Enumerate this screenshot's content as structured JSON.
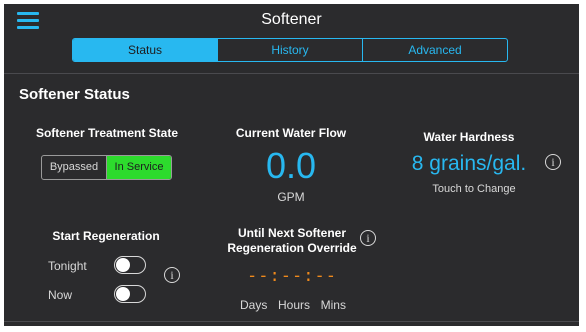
{
  "header": {
    "title": "Softener"
  },
  "tabs": [
    {
      "label": "Status",
      "active": true
    },
    {
      "label": "History",
      "active": false
    },
    {
      "label": "Advanced",
      "active": false
    }
  ],
  "section_title": "Softener Status",
  "treatment": {
    "label": "Softener Treatment State",
    "options": [
      "Bypassed",
      "In Service"
    ],
    "selected": "In Service"
  },
  "flow": {
    "label": "Current Water Flow",
    "value": "0.0",
    "unit": "GPM"
  },
  "hardness": {
    "label": "Water Hardness",
    "value": "8 grains/gal.",
    "hint": "Touch to Change"
  },
  "regeneration": {
    "label": "Start Regeneration",
    "tonight": {
      "label": "Tonight",
      "on": false
    },
    "now": {
      "label": "Now",
      "on": false
    }
  },
  "override": {
    "label_line1": "Until Next Softener",
    "label_line2": "Regeneration Override",
    "countdown": "--:--:--",
    "units": [
      "Days",
      "Hours",
      "Mins"
    ]
  },
  "info_glyph": "i",
  "colors": {
    "background": "#2b2b2d",
    "accent": "#28b8f0",
    "in_service": "#2ddb2d",
    "countdown": "#f08a1c"
  },
  "icons": {
    "menu": "hamburger-menu-icon",
    "info": "info-icon"
  }
}
